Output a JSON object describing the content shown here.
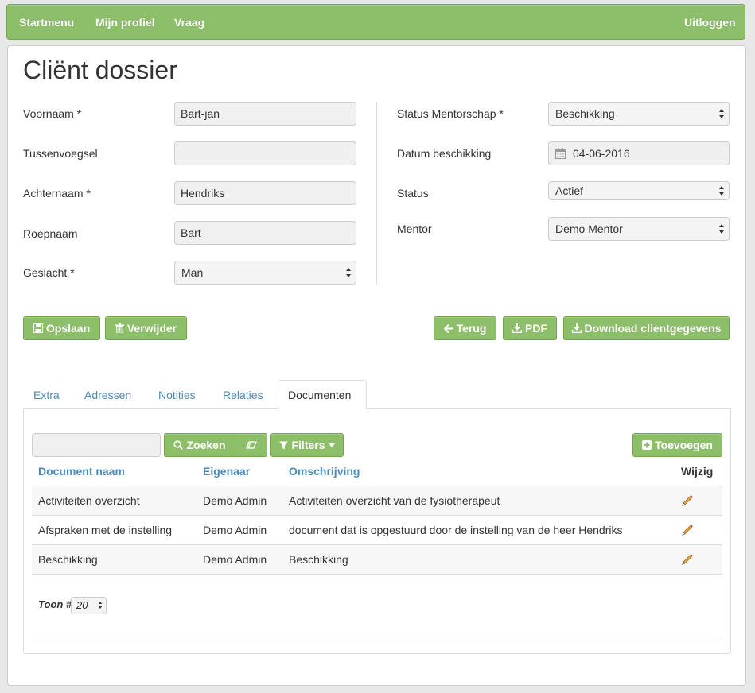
{
  "nav": {
    "startmenu": "Startmenu",
    "profiel": "Mijn profiel",
    "vraag": "Vraag",
    "uitloggen": "Uitloggen"
  },
  "page": {
    "title": "Cliënt dossier"
  },
  "form_left": {
    "voornaam_label": "Voornaam *",
    "voornaam_value": "Bart-jan",
    "tussenvoegsel_label": "Tussenvoegsel",
    "tussenvoegsel_value": "",
    "achternaam_label": "Achternaam *",
    "achternaam_value": "Hendriks",
    "roepnaam_label": "Roepnaam",
    "roepnaam_value": "Bart",
    "geslacht_label": "Geslacht *",
    "geslacht_value": "Man"
  },
  "form_right": {
    "status_mentorschap_label": "Status Mentorschap *",
    "status_mentorschap_value": "Beschikking",
    "datum_label": "Datum beschikking",
    "datum_value": "04-06-2016",
    "status_label": "Status",
    "status_value": "Actief",
    "mentor_label": "Mentor",
    "mentor_value": "Demo Mentor"
  },
  "actions": {
    "opslaan": "Opslaan",
    "verwijder": "Verwijder",
    "terug": "Terug",
    "pdf": "PDF",
    "download": "Download clientgegevens"
  },
  "tabs": [
    "Extra",
    "Adressen",
    "Notities",
    "Relaties",
    "Documenten"
  ],
  "documents": {
    "search_value": "",
    "zoeken": "Zoeken",
    "filters": "Filters",
    "toevoegen": "Toevoegen",
    "columns": [
      "Document naam",
      "Eigenaar",
      "Omschrijving",
      "Wijzig"
    ],
    "rows": [
      {
        "naam": "Activiteiten overzicht",
        "eigenaar": "Demo Admin",
        "omschrijving": "Activiteiten overzicht van de fysiotherapeut"
      },
      {
        "naam": "Afspraken met de instelling",
        "eigenaar": "Demo Admin",
        "omschrijving": "document dat is opgestuurd door de instelling van de heer Hendriks"
      },
      {
        "naam": "Beschikking",
        "eigenaar": "Demo Admin",
        "omschrijving": "Beschikking"
      }
    ],
    "toon_label": "Toon #",
    "toon_value": "20"
  },
  "colors": {
    "accent_green": "#8dbf6a",
    "link_blue": "#4a8ab8"
  }
}
